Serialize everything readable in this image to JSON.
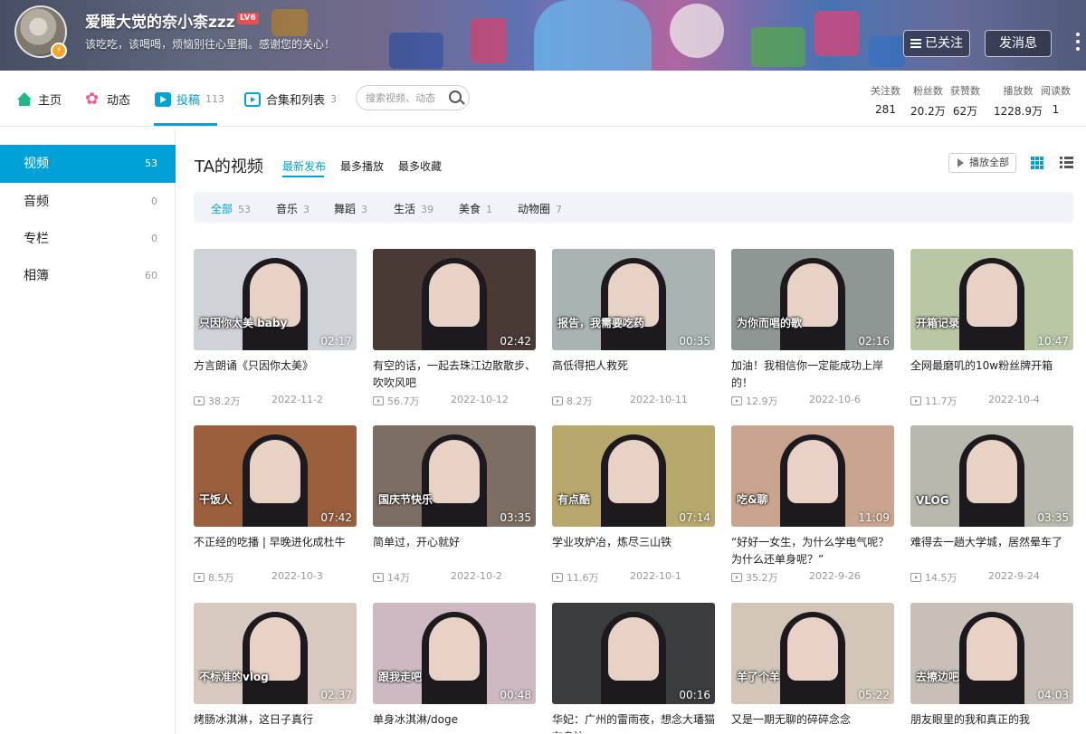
{
  "profile": {
    "name": "爱睡大觉的奈小柰zzz",
    "level": "LV6",
    "signature": "该吃吃，该喝喝，烦恼别往心里搁。感谢您的关心！",
    "followed_label": "已关注",
    "message_label": "发消息"
  },
  "nav": {
    "tabs": [
      {
        "label": "主页",
        "count": ""
      },
      {
        "label": "动态",
        "count": ""
      },
      {
        "label": "投稿",
        "count": "113"
      },
      {
        "label": "合集和列表",
        "count": "3"
      }
    ],
    "search_placeholder": "搜索视频、动态",
    "stats": [
      {
        "label": "关注数",
        "value": "281"
      },
      {
        "label": "粉丝数",
        "value": "20.2万"
      },
      {
        "label": "获赞数",
        "value": "62万"
      },
      {
        "label": "播放数",
        "value": "1228.9万"
      },
      {
        "label": "阅读数",
        "value": "1"
      }
    ]
  },
  "sidebar": {
    "items": [
      {
        "label": "视频",
        "count": "53"
      },
      {
        "label": "音频",
        "count": "0"
      },
      {
        "label": "专栏",
        "count": "0"
      },
      {
        "label": "相簿",
        "count": "60"
      }
    ]
  },
  "main": {
    "title": "TA的视频",
    "order_tabs": [
      "最新发布",
      "最多播放",
      "最多收藏"
    ],
    "play_all_label": "播放全部",
    "filters": [
      {
        "label": "全部",
        "count": "53"
      },
      {
        "label": "音乐",
        "count": "3"
      },
      {
        "label": "舞蹈",
        "count": "3"
      },
      {
        "label": "生活",
        "count": "39"
      },
      {
        "label": "美食",
        "count": "1"
      },
      {
        "label": "动物圈",
        "count": "7"
      }
    ]
  },
  "videos": [
    {
      "title": "方言朗诵《只因你太美》",
      "duration": "02:17",
      "plays": "38.2万",
      "date": "2022-11-2",
      "caption": "只因你太美 baby",
      "bg": "#cfd3d8"
    },
    {
      "title": "有空的话，一起去珠江边散散步、吹吹风吧",
      "duration": "02:42",
      "plays": "56.7万",
      "date": "2022-10-12",
      "caption": "",
      "bg": "#4a3a36"
    },
    {
      "title": "高低得把人救死",
      "duration": "00:35",
      "plays": "8.2万",
      "date": "2022-10-11",
      "caption": "报告，我需要吃药",
      "bg": "#aab3b4"
    },
    {
      "title": "加油！我相信你一定能成功上岸的！",
      "duration": "02:16",
      "plays": "12.9万",
      "date": "2022-10-6",
      "caption": "为你而唱的歌",
      "bg": "#8f9794"
    },
    {
      "title": "全网最磨叽的10w粉丝牌开箱",
      "duration": "10:47",
      "plays": "11.7万",
      "date": "2022-10-4",
      "caption": "开箱记录",
      "bg": "#b9c7a5"
    },
    {
      "title": "不正经的吃播 | 早晚进化成杜牛",
      "duration": "07:42",
      "plays": "8.5万",
      "date": "2022-10-3",
      "caption": "干饭人",
      "bg": "#9a5f3d"
    },
    {
      "title": "简单过，开心就好",
      "duration": "03:35",
      "plays": "14万",
      "date": "2022-10-2",
      "caption": "国庆节快乐",
      "bg": "#7d6e63"
    },
    {
      "title": "学业攻炉冶，炼尽三山铁",
      "duration": "07:14",
      "plays": "11.6万",
      "date": "2022-10-1",
      "caption": "有点酷",
      "bg": "#b8a86c"
    },
    {
      "title": "“好好一女生，为什么学电气呢？为什么还单身呢？”",
      "duration": "11:09",
      "plays": "35.2万",
      "date": "2022-9-26",
      "caption": "吃&聊",
      "bg": "#c9a48e"
    },
    {
      "title": "难得去一趟大学城，居然晕车了",
      "duration": "03:35",
      "plays": "14.5万",
      "date": "2022-9-24",
      "caption": "VLOG",
      "bg": "#b8b8ae"
    },
    {
      "title": "烤肠冰淇淋，这日子真行",
      "duration": "02:37",
      "plays": "",
      "date": "",
      "caption": "不标准的vlog",
      "bg": "#d8c9c0"
    },
    {
      "title": "单身冰淇淋/doge",
      "duration": "00:48",
      "plays": "",
      "date": "",
      "caption": "跟我走吧",
      "bg": "#cdb8c4"
    },
    {
      "title": "华妃：广州的雷雨夜，想念大璠猫在身边",
      "duration": "00:16",
      "plays": "",
      "date": "",
      "caption": "",
      "bg": "#3a3c40"
    },
    {
      "title": "又是一期无聊的碎碎念念",
      "duration": "05:22",
      "plays": "",
      "date": "",
      "caption": "羊了个羊",
      "bg": "#d3c6b9"
    },
    {
      "title": "朋友眼里的我和真正的我",
      "duration": "04:03",
      "plays": "",
      "date": "",
      "caption": "去擦边吧",
      "bg": "#c8c0b8"
    }
  ]
}
